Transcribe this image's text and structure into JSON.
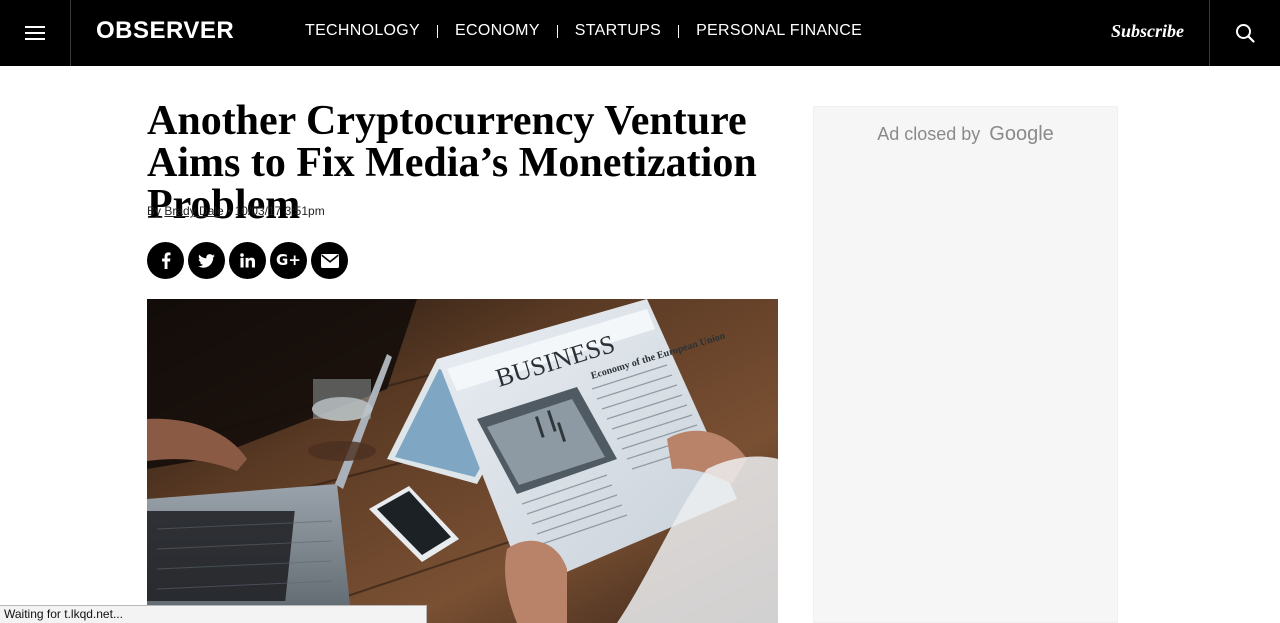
{
  "header": {
    "logo": "OBSERVER",
    "nav": [
      "TECHNOLOGY",
      "ECONOMY",
      "STARTUPS",
      "PERSONAL FINANCE"
    ],
    "subscribe_label": "Subscribe"
  },
  "article": {
    "headline": "Another Cryptocurrency Venture Aims to Fix Media’s Monetization Problem",
    "byline_prefix": "By",
    "author": "Brady Dale",
    "date_sep": "•",
    "date": "10/03/17 3:51pm",
    "share_icons": [
      "facebook-icon",
      "twitter-icon",
      "linkedin-icon",
      "google-plus-icon",
      "email-icon"
    ],
    "hero_image_alt": "",
    "newspaper_masthead": "BUSINESS",
    "newspaper_subhead": "Economy of the European Union"
  },
  "ad": {
    "label": "Ad closed by",
    "brand": "Google"
  },
  "status_bar": {
    "text": "Waiting for t.lkqd.net..."
  },
  "colors": {
    "topbar_bg": "#000000",
    "text": "#000000",
    "ad_bg": "#f6f6f6",
    "ad_text": "#8a8a8a"
  }
}
